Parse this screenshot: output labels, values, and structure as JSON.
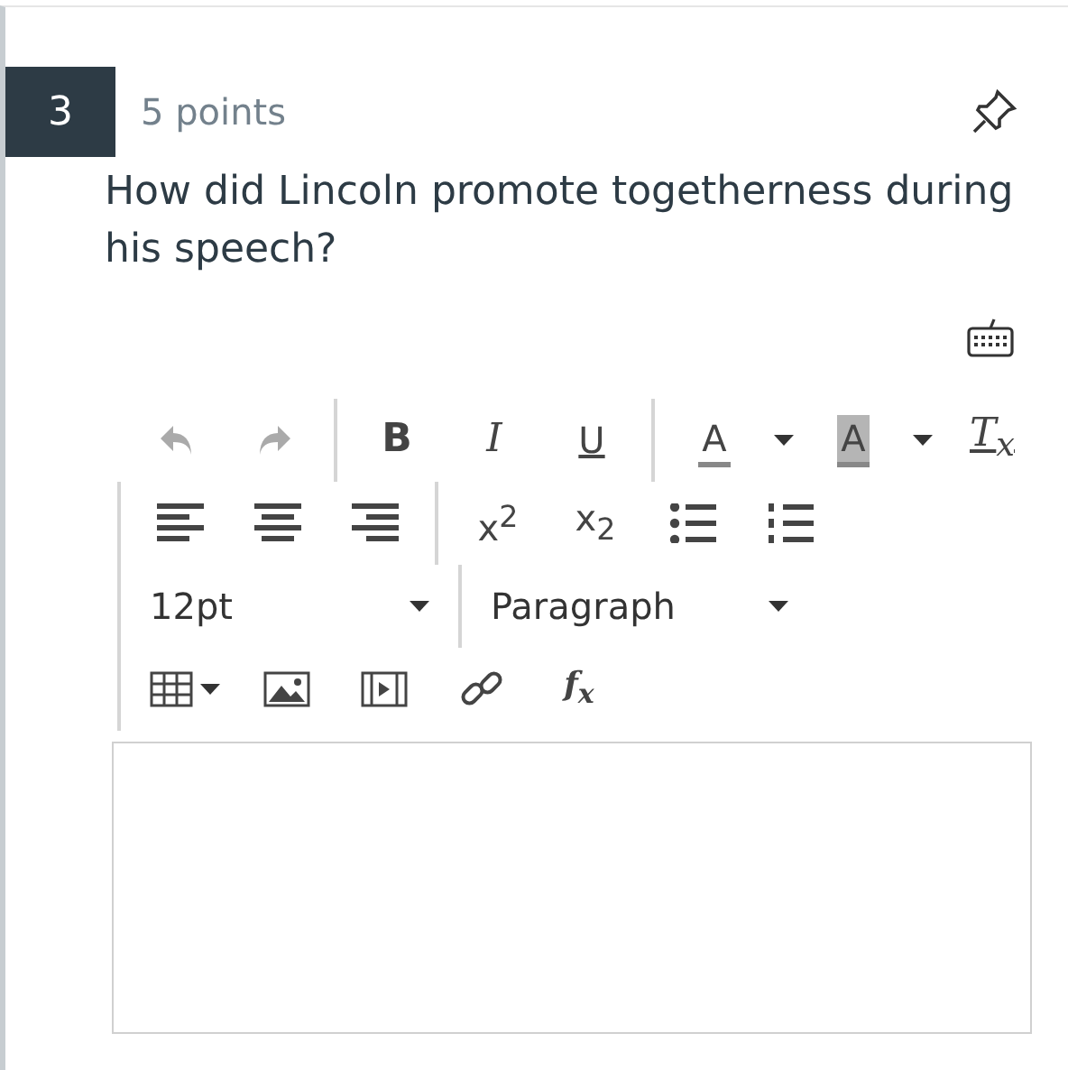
{
  "question": {
    "number": "3",
    "points": "5 points",
    "text": "How did Lincoln promote togetherness during his speech?"
  },
  "toolbar": {
    "rows": [
      {
        "groups": [
          [
            {
              "kind": "undo",
              "disabled": true
            },
            {
              "kind": "redo",
              "disabled": true
            }
          ],
          [
            {
              "kind": "bold",
              "glyph": "B"
            },
            {
              "kind": "italic",
              "glyph": "I"
            },
            {
              "kind": "underline",
              "glyph": "U"
            }
          ],
          [
            {
              "kind": "text-color",
              "glyph": "A"
            },
            {
              "kind": "caret"
            },
            {
              "kind": "highlight",
              "glyph": "A"
            },
            {
              "kind": "caret"
            },
            {
              "kind": "clear-format",
              "glyph": "T$_{x}$"
            }
          ]
        ]
      },
      {
        "groups": [
          [
            {
              "kind": "align-left"
            },
            {
              "kind": "align-center"
            },
            {
              "kind": "align-right"
            }
          ],
          [
            {
              "kind": "superscript",
              "glyph": "x$^{2}$"
            },
            {
              "kind": "subscript",
              "glyph": "x$_{2}$"
            },
            {
              "kind": "bullet-list"
            },
            {
              "kind": "numbered-list"
            }
          ]
        ]
      },
      {
        "groups": [
          [
            {
              "kind": "select",
              "value": "12pt"
            }
          ],
          [
            {
              "kind": "select",
              "value": "Paragraph"
            }
          ]
        ]
      },
      {
        "groups": [
          [
            {
              "kind": "table"
            },
            {
              "kind": "image"
            },
            {
              "kind": "video"
            },
            {
              "kind": "link"
            },
            {
              "kind": "equation",
              "glyph": "f$_{x}$"
            }
          ]
        ]
      }
    ]
  }
}
